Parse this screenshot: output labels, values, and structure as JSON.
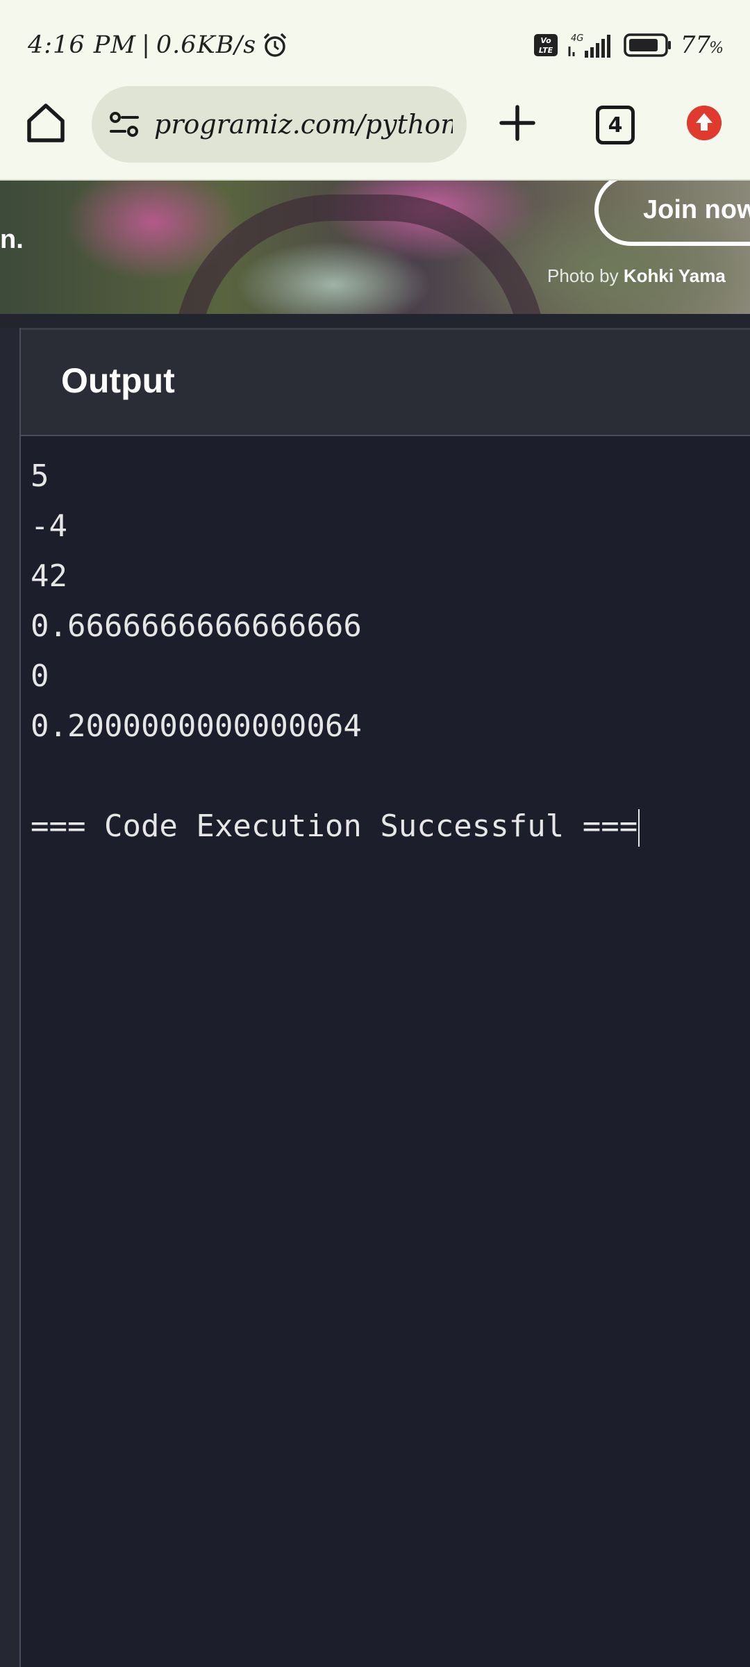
{
  "status_bar": {
    "time": "4:16 PM",
    "speed": "0.6KB/s",
    "network": "4G",
    "battery_percent": "77",
    "battery_percent_sign": "%",
    "volte_label": "Vo LTE"
  },
  "browser": {
    "url": "programiz.com/python-p",
    "tab_count": "4"
  },
  "banner": {
    "left_text": "n.",
    "join_label": "Join now",
    "photo_by": "Photo by",
    "photographer": "Kohki Yama"
  },
  "output": {
    "title": "Output",
    "lines": [
      "5",
      "-4",
      "42",
      "0.6666666666666666",
      "0",
      "0.2000000000000064",
      "",
      "=== Code Execution Successful ==="
    ]
  },
  "colors": {
    "terminal_bg": "#1c1f2b",
    "header_bg": "#2b2d36",
    "chrome_bg": "#f5f8ec",
    "update_badge": "#e03a2f"
  }
}
